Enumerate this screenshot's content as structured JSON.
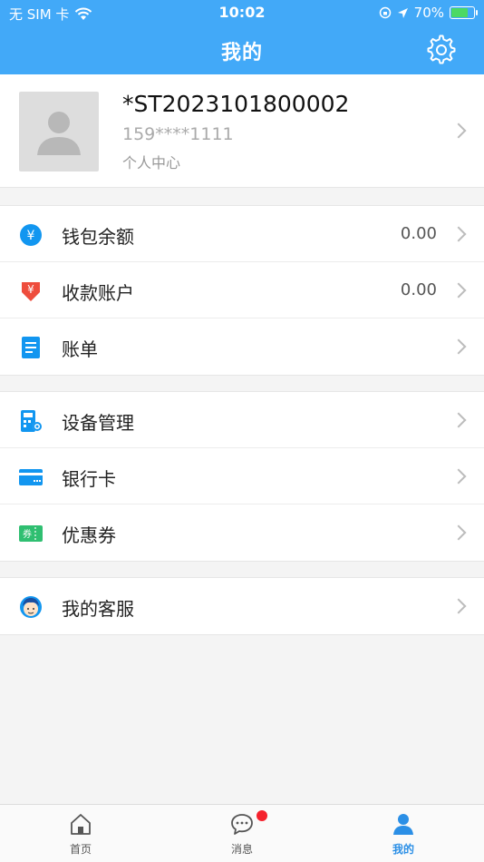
{
  "status_bar": {
    "carrier": "无 SIM 卡",
    "time": "10:02",
    "battery": "70%",
    "battery_level": 0.7
  },
  "nav": {
    "title": "我的"
  },
  "profile": {
    "name": "*ST2023101800002",
    "phone": "159****1111",
    "center_label": "个人中心"
  },
  "group1": [
    {
      "label": "钱包余额",
      "value": "0.00",
      "icon": "wallet-icon",
      "name": "wallet-balance"
    },
    {
      "label": "收款账户",
      "value": "0.00",
      "icon": "receive-account-icon",
      "name": "receive-account"
    },
    {
      "label": "账单",
      "value": "",
      "icon": "bill-icon",
      "name": "bill"
    }
  ],
  "group2": [
    {
      "label": "设备管理",
      "icon": "device-icon",
      "name": "device-management"
    },
    {
      "label": "银行卡",
      "icon": "bank-card-icon",
      "name": "bank-card"
    },
    {
      "label": "优惠券",
      "icon": "coupon-icon",
      "name": "coupon"
    }
  ],
  "group3": [
    {
      "label": "我的客服",
      "icon": "customer-service-icon",
      "name": "customer-service"
    }
  ],
  "icon_text": {
    "yen": "¥",
    "coupon": "券"
  },
  "tabs": [
    {
      "label": "首页"
    },
    {
      "label": "消息"
    },
    {
      "label": "我的"
    }
  ],
  "colors": {
    "primary": "#42a9f8",
    "active_tab": "#2b8fe6",
    "badge": "#f5222d"
  }
}
